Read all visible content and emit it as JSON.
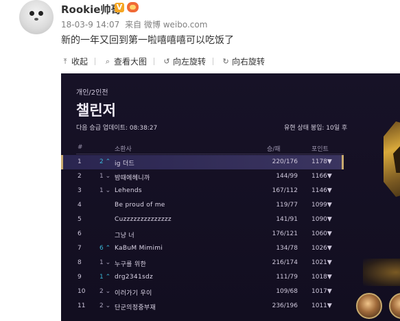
{
  "post": {
    "username": "Rookie帅哥",
    "verified_badge": "V",
    "meta_time": "18-03-9 14:07",
    "meta_source": "来自 微博 weibo.com",
    "text": "新的一年又回到第一啦嘻嘻嘻可以吃饭了"
  },
  "toolbar": {
    "collapse": "收起",
    "view_large": "查看大图",
    "rotate_left": "向左旋转",
    "rotate_right": "向右旋转"
  },
  "game": {
    "breadcrumb": "개인/2인전",
    "title": "챌린저",
    "update_text": "다음 승급 업데이트: 08:38:27",
    "limit_text": "유현 상태 봉입: 10일 후",
    "headers": {
      "rank": "#",
      "summoner": "소환사",
      "wl": "승/패",
      "lp": "포인트"
    },
    "rows": [
      {
        "rank": "1",
        "chg": "2 ⌃",
        "name": "ig 더드",
        "wl": "220/176",
        "lp": "1178▼"
      },
      {
        "rank": "2",
        "chg": "1 ⌄",
        "name": "밤때에헤니까",
        "wl": "144/99",
        "lp": "1166▼"
      },
      {
        "rank": "3",
        "chg": "1 ⌄",
        "name": "Lehends",
        "wl": "167/112",
        "lp": "1146▼"
      },
      {
        "rank": "4",
        "chg": "",
        "name": "Be proud of me",
        "wl": "119/77",
        "lp": "1099▼"
      },
      {
        "rank": "5",
        "chg": "",
        "name": "Cuzzzzzzzzzzzzzz",
        "wl": "141/91",
        "lp": "1090▼"
      },
      {
        "rank": "6",
        "chg": "",
        "name": "그냥 너",
        "wl": "176/121",
        "lp": "1060▼"
      },
      {
        "rank": "7",
        "chg": "6 ⌃",
        "name": "KaBuM Mimimi",
        "wl": "134/78",
        "lp": "1026▼"
      },
      {
        "rank": "8",
        "chg": "1 ⌄",
        "name": "누구를 위한",
        "wl": "216/174",
        "lp": "1021▼"
      },
      {
        "rank": "9",
        "chg": "1 ⌃",
        "name": "drg2341sdz",
        "wl": "111/79",
        "lp": "1018▼"
      },
      {
        "rank": "10",
        "chg": "2 ⌄",
        "name": "이러가기 우이",
        "wl": "109/68",
        "lp": "1017▼"
      },
      {
        "rank": "11",
        "chg": "2 ⌄",
        "name": "단군의정중부재",
        "wl": "236/196",
        "lp": "1011▼"
      }
    ]
  }
}
